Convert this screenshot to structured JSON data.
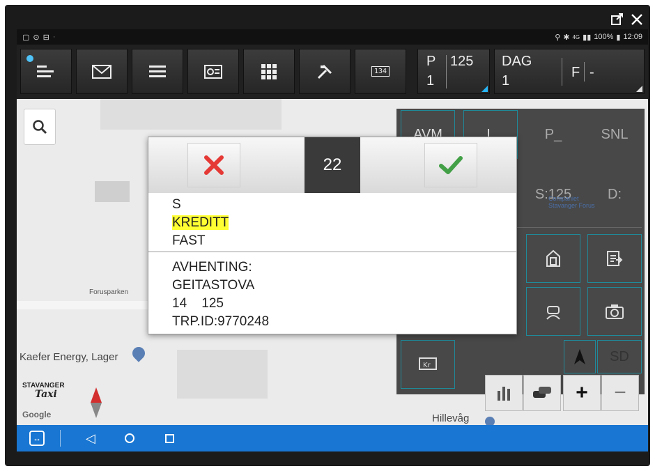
{
  "window": {
    "icons": {
      "popout": "popout-icon",
      "close": "close-icon"
    }
  },
  "statusbar": {
    "battery": "100%",
    "time": "12:09",
    "signal_text": "4G",
    "icons": [
      "square-notification-icon",
      "loop-icon",
      "app-icon",
      "location-icon",
      "bluetooth-icon",
      "signal-icon",
      "battery-icon"
    ]
  },
  "toolbar": {
    "buttons": [
      {
        "name": "menu-list-icon"
      },
      {
        "name": "mail-icon"
      },
      {
        "name": "list-icon"
      },
      {
        "name": "receipt-icon"
      },
      {
        "name": "grid-icon"
      },
      {
        "name": "tools-icon"
      },
      {
        "name": "meter-icon",
        "label": "134"
      }
    ],
    "p_box": {
      "top_left": "P",
      "top_right": "125",
      "bottom": "1"
    },
    "dag_box": {
      "top": "DAG",
      "bottom": "1",
      "right": "F",
      "dash": "-"
    }
  },
  "map": {
    "labels": {
      "forusparken": "Forusparken",
      "kaefer": "Kaefer Energy, Lager",
      "hillevag": "Hillevåg",
      "companiet": "Companiet\nStavanger Forus",
      "google": "Google"
    },
    "logo": {
      "line1": "STAVANGER",
      "line2": "Taxi"
    }
  },
  "right_panel": {
    "buttons": [
      "AVM",
      "L",
      "P_",
      "SNL",
      "S:125",
      "D:"
    ]
  },
  "dialog": {
    "count": "22",
    "section1": [
      "S",
      "KREDITT",
      "FAST"
    ],
    "section2": [
      "AVHENTING:",
      "GEITASTOVA",
      "14    125",
      "TRP.ID:9770248"
    ],
    "highlight_index": 1,
    "colors": {
      "cancel": "#e53935",
      "confirm": "#43a047",
      "highlight": "#ffff33"
    }
  },
  "bottom_buttons": {
    "plus": "+",
    "minus": "−",
    "sd": "SD"
  }
}
